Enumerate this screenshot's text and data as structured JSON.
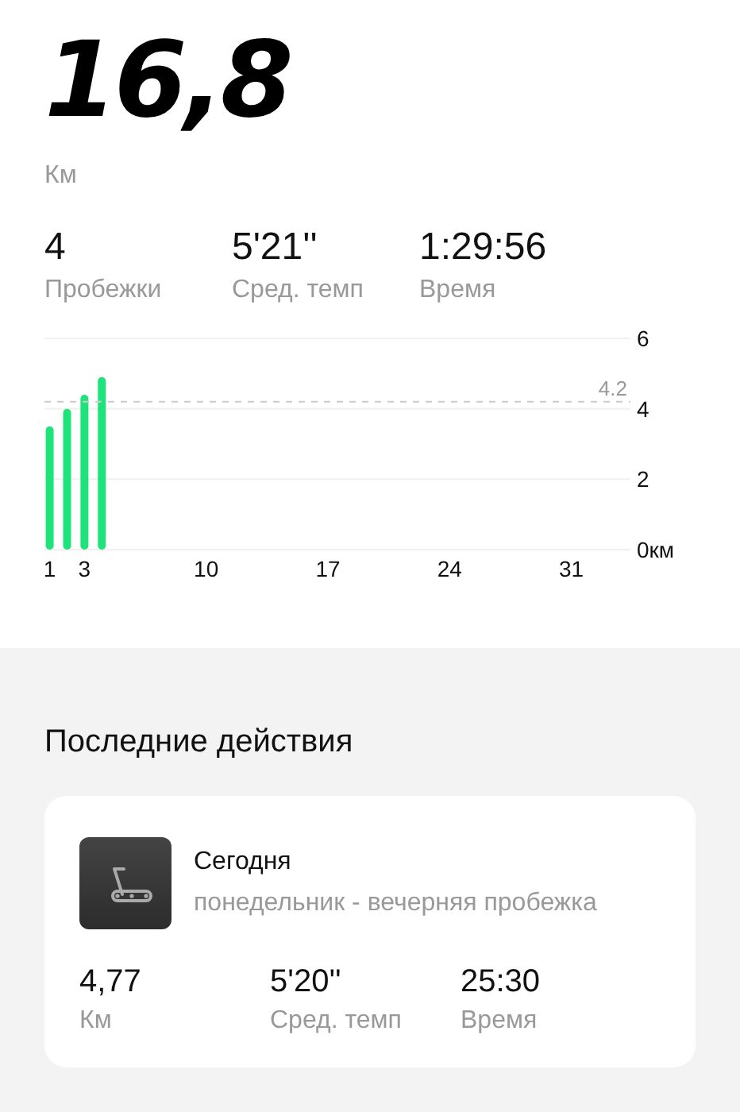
{
  "summary": {
    "distance": "16,8",
    "distance_unit": "Км",
    "stats": [
      {
        "value": "4",
        "label": "Пробежки"
      },
      {
        "value": "5'21''",
        "label": "Сред. темп"
      },
      {
        "value": "1:29:56",
        "label": "Время"
      }
    ]
  },
  "chart": {
    "chart_data": {
      "type": "bar",
      "x": [
        1,
        2,
        3,
        4
      ],
      "series": [
        {
          "color": "#1ee37a",
          "values": [
            3.5,
            4.0,
            4.4,
            4.9
          ]
        }
      ],
      "xlim": [
        0.7,
        34.4
      ],
      "ylim": [
        0,
        6
      ],
      "xticks": [
        1,
        3,
        10,
        17,
        24,
        31
      ],
      "yticks": [
        {
          "value": 0,
          "label": "0км"
        },
        2,
        4,
        6
      ],
      "ref_lines": [
        {
          "axis": "y",
          "value": 4.2,
          "label": "4.2"
        }
      ]
    }
  },
  "recent": {
    "title": "Последние действия",
    "activities": [
      {
        "kind": "treadmill",
        "day": "Сегодня",
        "description": "понедельник - вечерняя пробежка",
        "stats": [
          {
            "value": "4,77",
            "label": "Км"
          },
          {
            "value": "5'20''",
            "label": "Сред. темп"
          },
          {
            "value": "25:30",
            "label": "Время"
          }
        ]
      }
    ]
  }
}
